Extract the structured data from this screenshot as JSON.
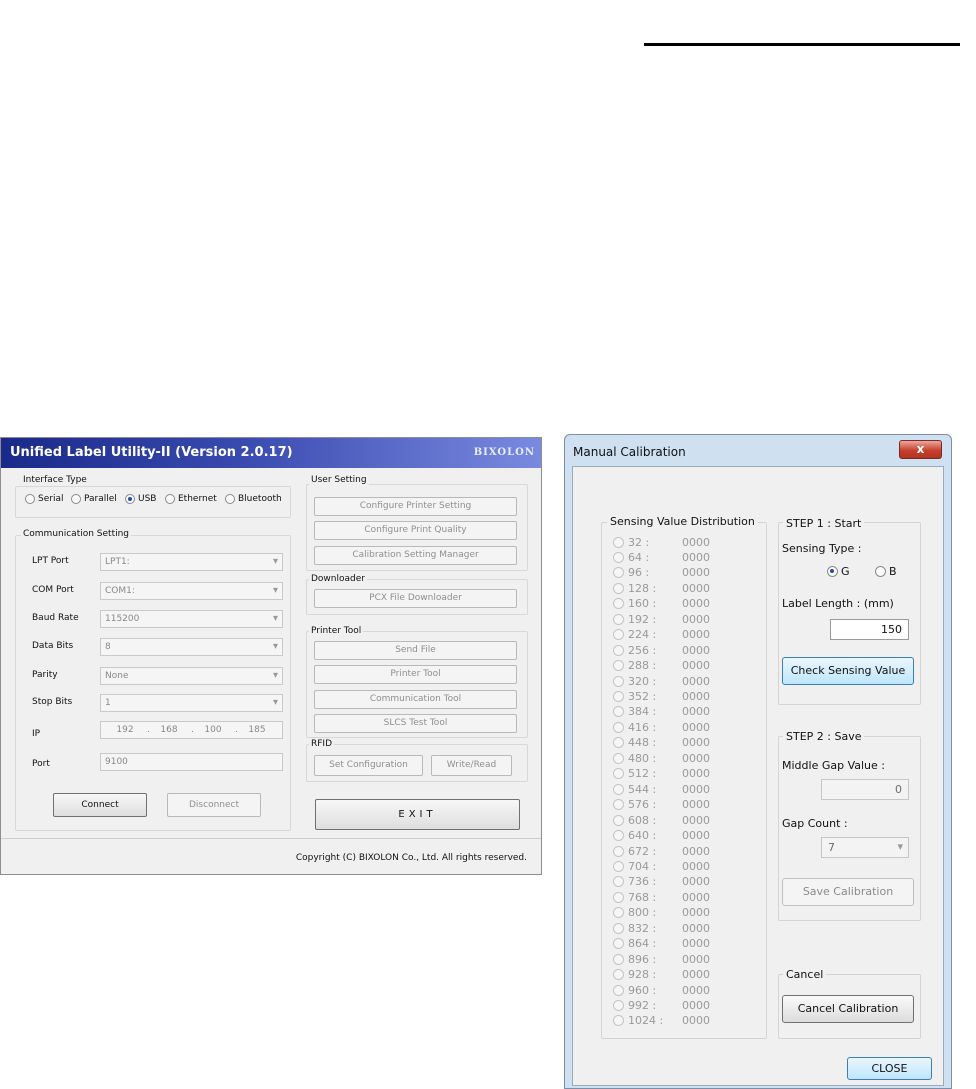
{
  "left_window": {
    "title": "Unified Label Utility-II (Version 2.0.17)",
    "brand": "BIXOLON",
    "interface_type": {
      "label": "Interface Type",
      "options": [
        "Serial",
        "Parallel",
        "USB",
        "Ethernet",
        "Bluetooth"
      ],
      "selected": "USB"
    },
    "communication": {
      "label": "Communication Setting",
      "lpt_port": {
        "label": "LPT Port",
        "value": "LPT1:"
      },
      "com_port": {
        "label": "COM Port",
        "value": "COM1:"
      },
      "baud_rate": {
        "label": "Baud Rate",
        "value": "115200"
      },
      "data_bits": {
        "label": "Data Bits",
        "value": "8"
      },
      "parity": {
        "label": "Parity",
        "value": "None"
      },
      "stop_bits": {
        "label": "Stop Bits",
        "value": "1"
      },
      "ip": {
        "label": "IP",
        "octets": [
          "192",
          "168",
          "100",
          "185"
        ]
      },
      "port": {
        "label": "Port",
        "value": "9100"
      },
      "connect": "Connect",
      "disconnect": "Disconnect"
    },
    "user_setting": {
      "label": "User Setting",
      "buttons": [
        "Configure Printer Setting",
        "Configure Print Quality",
        "Calibration Setting Manager"
      ]
    },
    "downloader": {
      "label": "Downloader",
      "buttons": [
        "PCX File Downloader"
      ]
    },
    "printer_tool": {
      "label": "Printer Tool",
      "buttons": [
        "Send File",
        "Printer Tool",
        "Communication Tool",
        "SLCS Test Tool"
      ]
    },
    "rfid": {
      "label": "RFID",
      "set_configuration": "Set Configuration",
      "write_read": "Write/Read"
    },
    "exit": "EXIT",
    "copyright": "Copyright (C) BIXOLON Co., Ltd. All rights reserved."
  },
  "right_window": {
    "title": "Manual Calibration",
    "close_glyph": "x",
    "sensing": {
      "label": "Sensing Value Distribution",
      "rows": [
        {
          "key": "32 :",
          "value": "0000"
        },
        {
          "key": "64 :",
          "value": "0000"
        },
        {
          "key": "96 :",
          "value": "0000"
        },
        {
          "key": "128 :",
          "value": "0000"
        },
        {
          "key": "160 :",
          "value": "0000"
        },
        {
          "key": "192 :",
          "value": "0000"
        },
        {
          "key": "224 :",
          "value": "0000"
        },
        {
          "key": "256 :",
          "value": "0000"
        },
        {
          "key": "288 :",
          "value": "0000"
        },
        {
          "key": "320 :",
          "value": "0000"
        },
        {
          "key": "352 :",
          "value": "0000"
        },
        {
          "key": "384 :",
          "value": "0000"
        },
        {
          "key": "416 :",
          "value": "0000"
        },
        {
          "key": "448 :",
          "value": "0000"
        },
        {
          "key": "480 :",
          "value": "0000"
        },
        {
          "key": "512 :",
          "value": "0000"
        },
        {
          "key": "544 :",
          "value": "0000"
        },
        {
          "key": "576 :",
          "value": "0000"
        },
        {
          "key": "608 :",
          "value": "0000"
        },
        {
          "key": "640 :",
          "value": "0000"
        },
        {
          "key": "672 :",
          "value": "0000"
        },
        {
          "key": "704 :",
          "value": "0000"
        },
        {
          "key": "736 :",
          "value": "0000"
        },
        {
          "key": "768 :",
          "value": "0000"
        },
        {
          "key": "800 :",
          "value": "0000"
        },
        {
          "key": "832 :",
          "value": "0000"
        },
        {
          "key": "864 :",
          "value": "0000"
        },
        {
          "key": "896 :",
          "value": "0000"
        },
        {
          "key": "928 :",
          "value": "0000"
        },
        {
          "key": "960 :",
          "value": "0000"
        },
        {
          "key": "992 :",
          "value": "0000"
        },
        {
          "key": "1024 :",
          "value": "0000"
        }
      ]
    },
    "step1": {
      "label": "STEP 1 : Start",
      "sensing_type_label": "Sensing Type :",
      "options": [
        "G",
        "B"
      ],
      "selected": "G",
      "label_length_label": "Label Length : (mm)",
      "label_length_value": "150",
      "check_button": "Check Sensing Value"
    },
    "step2": {
      "label": "STEP 2 : Save",
      "middle_gap_label": "Middle Gap Value :",
      "middle_gap_value": "0",
      "gap_count_label": "Gap Count :",
      "gap_count_value": "7",
      "save_button": "Save Calibration"
    },
    "cancel": {
      "label": "Cancel",
      "button": "Cancel Calibration"
    },
    "close_button": "CLOSE"
  }
}
